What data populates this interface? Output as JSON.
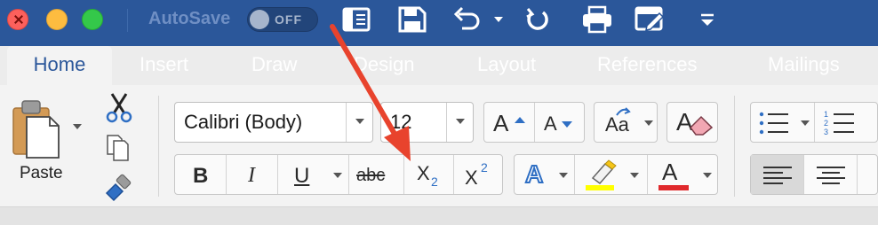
{
  "titlebar": {
    "autosave_label": "AutoSave",
    "autosave_state": "OFF",
    "bg_color": "#2b579a",
    "quick_access_icons": [
      "sidebar-icon",
      "save-icon",
      "undo-icon",
      "redo-icon",
      "print-icon",
      "edit-icon",
      "customize-icon"
    ]
  },
  "tabs": [
    {
      "label": "Home",
      "active": true
    },
    {
      "label": "Insert"
    },
    {
      "label": "Draw"
    },
    {
      "label": "Design"
    },
    {
      "label": "Layout"
    },
    {
      "label": "References"
    },
    {
      "label": "Mailings"
    }
  ],
  "clipboard": {
    "paste_label": "Paste"
  },
  "font": {
    "family": "Calibri (Body)",
    "size": "12"
  },
  "format_buttons": {
    "bold": "B",
    "italic": "I",
    "underline": "U",
    "strikethrough": "abc",
    "subscript": "X",
    "subscript_mark": "2",
    "superscript": "X",
    "superscript_mark": "2",
    "grow": "A",
    "shrink": "A",
    "change_case": "Aa",
    "text_effects": "A",
    "font_color": "A"
  },
  "colors": {
    "highlight": "#ffff00",
    "font_color": "#e0292c",
    "arrow": "#e8432d"
  }
}
